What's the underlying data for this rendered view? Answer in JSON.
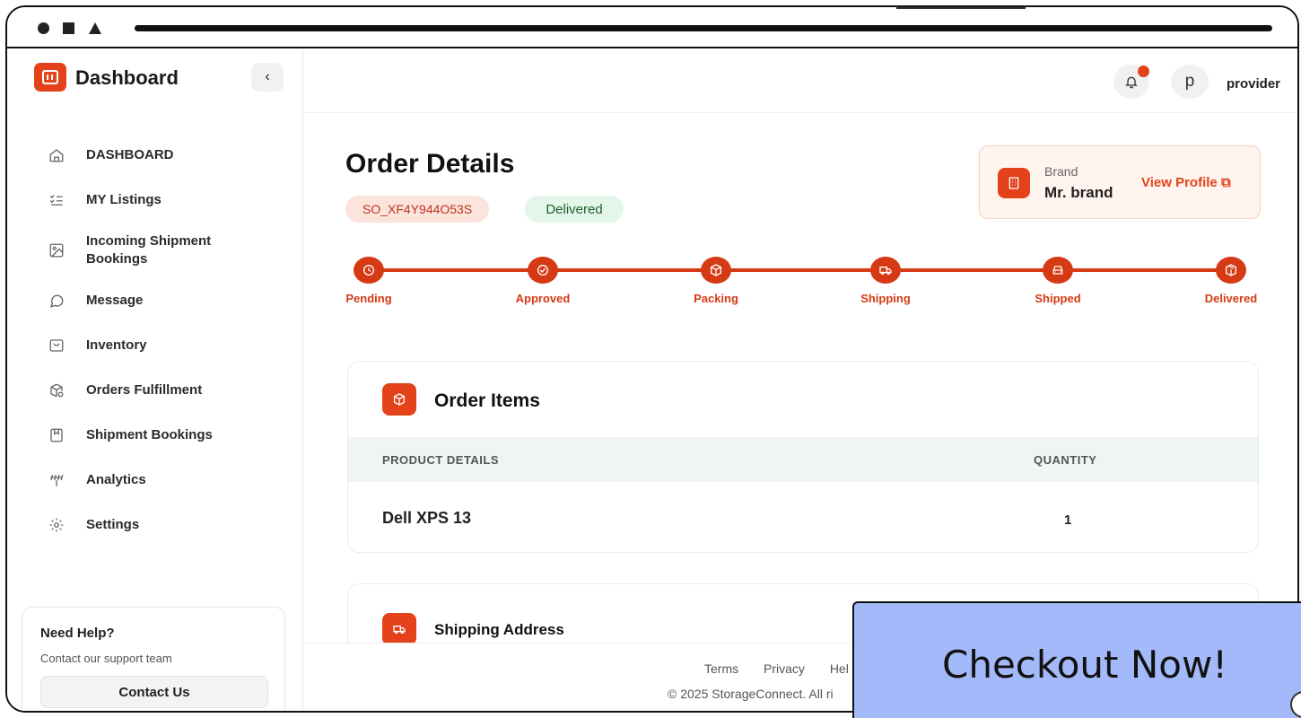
{
  "app": {
    "title": "Dashboard"
  },
  "sidebar": {
    "items": [
      {
        "label": "DASHBOARD",
        "icon": "home-icon"
      },
      {
        "label": "MY Listings",
        "icon": "list-check-icon"
      },
      {
        "label": "Incoming Shipment Bookings",
        "icon": "image-icon"
      },
      {
        "label": "Message",
        "icon": "message-icon"
      },
      {
        "label": "Inventory",
        "icon": "inbox-icon"
      },
      {
        "label": "Orders Fulfillment",
        "icon": "package-search-icon"
      },
      {
        "label": "Shipment Bookings",
        "icon": "book-icon"
      },
      {
        "label": "Analytics",
        "icon": "analytics-icon"
      },
      {
        "label": "Settings",
        "icon": "gear-icon"
      }
    ],
    "help": {
      "title": "Need Help?",
      "subtitle": "Contact our support team",
      "button": "Contact Us"
    }
  },
  "header": {
    "avatar_letter": "p",
    "username": "provider"
  },
  "order": {
    "title": "Order Details",
    "id": "SO_XF4Y944O53S",
    "status": "Delivered",
    "brand_label": "Brand",
    "brand_name": "Mr. brand",
    "view_profile": "View Profile"
  },
  "steps": [
    {
      "label": "Pending",
      "icon": "clock-icon"
    },
    {
      "label": "Approved",
      "icon": "check-circle-icon"
    },
    {
      "label": "Packing",
      "icon": "box-icon"
    },
    {
      "label": "Shipping",
      "icon": "truck-icon"
    },
    {
      "label": "Shipped",
      "icon": "car-icon"
    },
    {
      "label": "Delivered",
      "icon": "package-icon"
    }
  ],
  "items_card": {
    "title": "Order Items",
    "col_product": "PRODUCT DETAILS",
    "col_quantity": "QUANTITY",
    "rows": [
      {
        "product": "Dell XPS 13",
        "quantity": "1"
      }
    ]
  },
  "shipping_card": {
    "title": "Shipping Address"
  },
  "footer": {
    "links": [
      "Terms",
      "Privacy",
      "Hel"
    ],
    "copyright": "© 2025 StorageConnect. All ri"
  },
  "overlay": {
    "cta": "Checkout Now!"
  },
  "colors": {
    "accent": "#e3421a",
    "stepper": "#d53a15",
    "overlay": "#a4b9f9"
  }
}
